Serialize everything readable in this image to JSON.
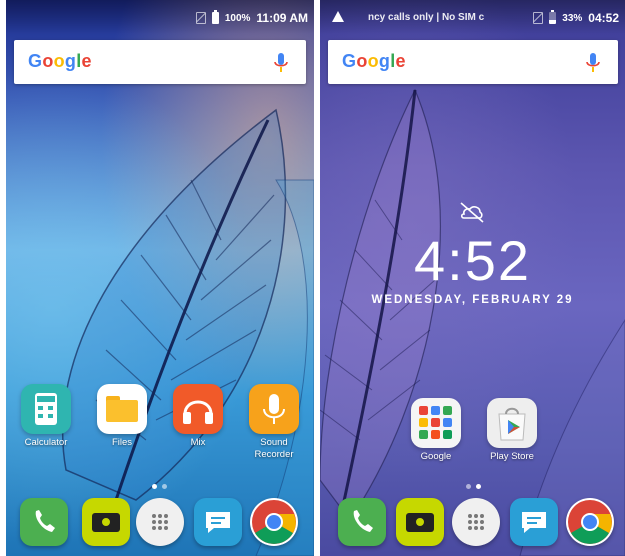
{
  "left_screen": {
    "status": {
      "battery_pct": "100%",
      "time": "11:09 AM"
    },
    "search": {
      "logo": "Google"
    },
    "apps": [
      {
        "label": "Calculator",
        "icon": "calculator-icon"
      },
      {
        "label": "Files",
        "icon": "files-folder-icon"
      },
      {
        "label": "Mix",
        "icon": "headphones-icon"
      },
      {
        "label": "Sound\nRecorder",
        "icon": "microphone-icon"
      }
    ],
    "dock": [
      "phone-icon",
      "camera-icon",
      "app-drawer-icon",
      "messages-icon",
      "chrome-icon"
    ]
  },
  "right_screen": {
    "status": {
      "notice": "ncy calls only | No SIM c",
      "battery_pct": "33%",
      "time": "04:52"
    },
    "search": {
      "logo": "Google"
    },
    "lock": {
      "time": "4:52",
      "date": "WEDNESDAY, FEBRUARY 29"
    },
    "apps": [
      {
        "label": "Google",
        "icon": "google-folder-icon"
      },
      {
        "label": "Play Store",
        "icon": "play-store-icon"
      }
    ],
    "dock": [
      "phone-icon",
      "camera-icon",
      "app-drawer-icon",
      "messages-icon",
      "chrome-icon"
    ]
  },
  "colors": {
    "calculator": "#2fb5b0",
    "files": "#ffffff",
    "mix": "#f15a29",
    "recorder": "#f7a21b",
    "phone": "#4caf50",
    "camera": "#c6d800",
    "messages": "#2a9fd6"
  }
}
